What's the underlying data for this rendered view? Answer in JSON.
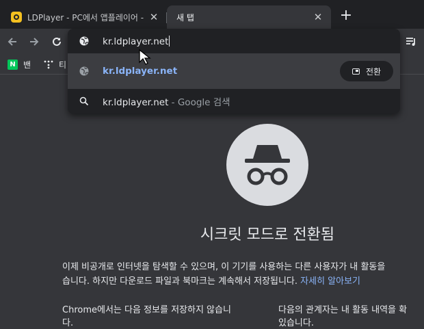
{
  "tabs": [
    {
      "title": "LDPlayer - PC에서 앱플레이어 -",
      "close": "✕"
    },
    {
      "title": "새 탭",
      "close": "✕"
    }
  ],
  "newtab_label": "+",
  "bookmarks": [
    {
      "label": "밴",
      "icon": "naver-icon"
    },
    {
      "label": "티",
      "icon": "dots-icon"
    }
  ],
  "omnibox": {
    "input_value": "kr.ldplayer.net",
    "suggestion_url": "kr.ldplayer.net",
    "switch_label": "전환",
    "search_query": "kr.ldplayer.net",
    "search_suffix": " - Google 검색"
  },
  "incognito": {
    "heading": "시크릿 모드로 전환됨",
    "para_line1": "이제 비공개로 인터넷을 탐색할 수 있으며, 이 기기를 사용하는 다른 사용자가 내 활동을",
    "para_line2": "습니다. 하지만 다운로드 파일과 북마크는 계속해서 저장됩니다. ",
    "learn_more": "자세히 알아보기",
    "left_line1": "Chrome에서는 다음 정보를 저장하지 않습니",
    "left_line2": "다.",
    "right_line1": "다음의 관계자는 내 활동 내역을 확",
    "right_line2": "있습니다."
  },
  "colors": {
    "tabstrip_bg": "#202124",
    "content_bg": "#35363a",
    "accent_link": "#8ab4f8",
    "favicon": "#f4c020",
    "naver_green": "#03c75a"
  }
}
